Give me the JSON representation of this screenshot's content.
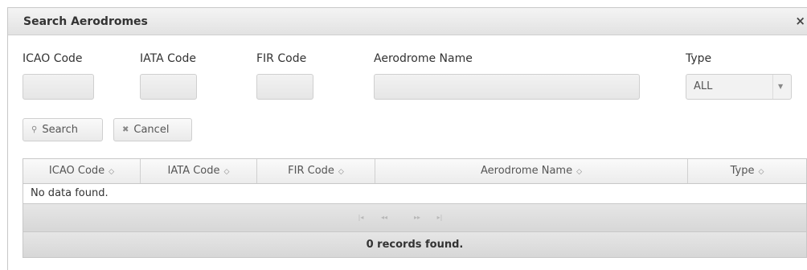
{
  "dialog": {
    "title": "Search Aerodromes",
    "close_glyph": "×"
  },
  "form": {
    "icao_label": "ICAO Code",
    "iata_label": "IATA Code",
    "fir_label": "FIR Code",
    "name_label": "Aerodrome Name",
    "type_label": "Type",
    "icao_value": "",
    "iata_value": "",
    "fir_value": "",
    "name_value": "",
    "type_value": "ALL",
    "search_label": "Search",
    "cancel_label": "Cancel"
  },
  "table": {
    "columns": [
      "ICAO Code",
      "IATA Code",
      "FIR Code",
      "Aerodrome Name",
      "Type"
    ],
    "sort_glyph": "◇",
    "empty_message": "No data found.",
    "pager": [
      "|◂",
      "◂◂",
      "▸▸",
      "▸|"
    ],
    "footer": "0 records found."
  }
}
